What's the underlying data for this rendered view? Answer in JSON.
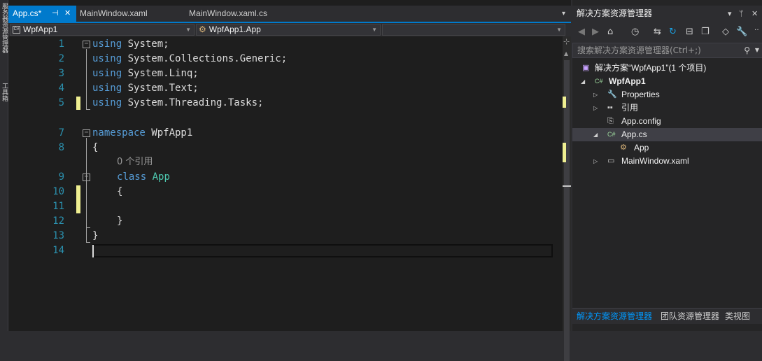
{
  "left_strip": {
    "labels": [
      "服务器资源管理器",
      "工具箱"
    ]
  },
  "tabs": [
    {
      "label": "App.cs*",
      "pin": "⊣",
      "close": "✕"
    },
    {
      "label": "MainWindow.xaml"
    },
    {
      "label": "MainWindow.xaml.cs"
    }
  ],
  "tabbar_dropdown": "▾",
  "navbar": {
    "project": "WpfApp1",
    "type": "WpfApp1.App",
    "member": ""
  },
  "code": {
    "line_numbers": [
      "1",
      "2",
      "3",
      "4",
      "5",
      "",
      "7",
      "8",
      "",
      "9",
      "10",
      "11",
      "12",
      "13",
      "14"
    ],
    "lines": {
      "l1_kw": "using",
      "l1_rest": " System;",
      "l2_kw": "using",
      "l2_rest": " System.Collections.Generic;",
      "l3_kw": "using",
      "l3_rest": " System.Linq;",
      "l4_kw": "using",
      "l4_rest": " System.Text;",
      "l5_kw": "using",
      "l5_rest": " System.Threading.Tasks;",
      "l7_kw": "namespace",
      "l7_rest": " WpfApp1",
      "l8": "{",
      "ref": "0 个引用",
      "l9_kw": "class",
      "l9_type": "App",
      "l10": "{",
      "l12": "}",
      "l13": "}"
    }
  },
  "solution_explorer": {
    "title": "解决方案资源管理器",
    "title_buttons": {
      "dropdown": "▾",
      "pin": "ᛘ",
      "close": "✕"
    },
    "toolbar": {
      "back": "◀",
      "forward": "▶",
      "home": "⌂",
      "history": "◷",
      "sync": "⇆",
      "refresh": "↻",
      "collapse": "⊟",
      "copy": "❐",
      "code": "◇",
      "settings": "🔧",
      "more": "‥"
    },
    "search_placeholder": "搜索解决方案资源管理器(Ctrl+;)",
    "search_icon": "⚲",
    "tree": [
      {
        "label": "解决方案“WpfApp1”(1 个项目)",
        "icon": "solution-icon"
      },
      {
        "label": "WpfApp1",
        "icon": "csharp-project-icon"
      },
      {
        "label": "Properties",
        "icon": "wrench-icon"
      },
      {
        "label": "引用",
        "icon": "references-icon"
      },
      {
        "label": "App.config",
        "icon": "config-icon"
      },
      {
        "label": "App.cs",
        "icon": "csharp-file-icon"
      },
      {
        "label": "App",
        "icon": "class-icon"
      },
      {
        "label": "MainWindow.xaml",
        "icon": "xaml-file-icon"
      }
    ],
    "bottom_tabs": [
      "解决方案资源管理器",
      "团队资源管理器",
      "类视图"
    ]
  },
  "colors": {
    "accent": "#007acc",
    "keyword": "#569cd6",
    "type": "#4ec9b0",
    "line_number": "#2b91af",
    "change_marker": "#efef91"
  }
}
